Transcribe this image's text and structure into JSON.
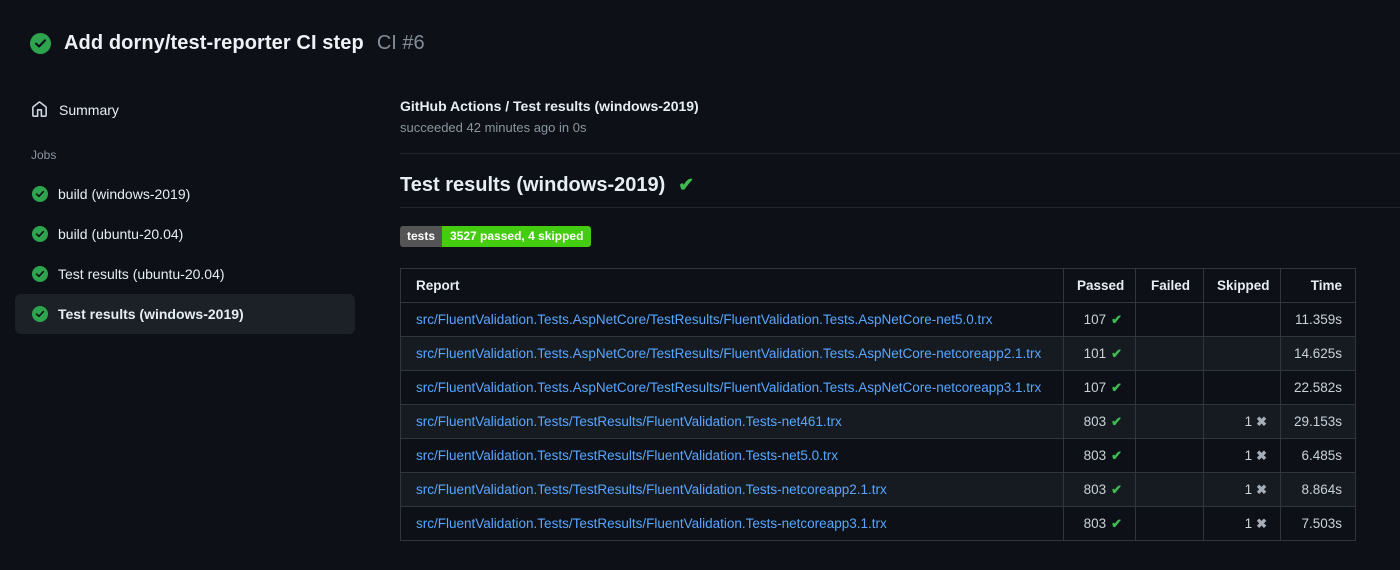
{
  "app_header": {
    "title": "Add dorny/test-reporter CI step",
    "run_ref": "CI #6"
  },
  "sidebar": {
    "summary_label": "Summary",
    "jobs_section_label": "Jobs",
    "jobs": [
      {
        "label": "build (windows-2019)",
        "status": "success",
        "selected": false
      },
      {
        "label": "build (ubuntu-20.04)",
        "status": "success",
        "selected": false
      },
      {
        "label": "Test results (ubuntu-20.04)",
        "status": "success",
        "selected": false
      },
      {
        "label": "Test results (windows-2019)",
        "status": "success",
        "selected": true
      }
    ]
  },
  "main": {
    "check_run_title": "GitHub Actions / Test results (windows-2019)",
    "check_run_status": "succeeded 42 minutes ago in 0s",
    "section_heading": "Test results (windows-2019)",
    "badge": {
      "label": "tests",
      "value": "3527 passed, 4 skipped"
    },
    "table": {
      "headers": [
        "Report",
        "Passed",
        "Failed",
        "Skipped",
        "Time"
      ],
      "rows": [
        {
          "report": "src/FluentValidation.Tests.AspNetCore/TestResults/FluentValidation.Tests.AspNetCore-net5.0.trx",
          "passed": "107",
          "failed": "",
          "skipped": "",
          "time": "11.359s"
        },
        {
          "report": "src/FluentValidation.Tests.AspNetCore/TestResults/FluentValidation.Tests.AspNetCore-netcoreapp2.1.trx",
          "passed": "101",
          "failed": "",
          "skipped": "",
          "time": "14.625s"
        },
        {
          "report": "src/FluentValidation.Tests.AspNetCore/TestResults/FluentValidation.Tests.AspNetCore-netcoreapp3.1.trx",
          "passed": "107",
          "failed": "",
          "skipped": "",
          "time": "22.582s"
        },
        {
          "report": "src/FluentValidation.Tests/TestResults/FluentValidation.Tests-net461.trx",
          "passed": "803",
          "failed": "",
          "skipped": "1",
          "time": "29.153s"
        },
        {
          "report": "src/FluentValidation.Tests/TestResults/FluentValidation.Tests-net5.0.trx",
          "passed": "803",
          "failed": "",
          "skipped": "1",
          "time": "6.485s"
        },
        {
          "report": "src/FluentValidation.Tests/TestResults/FluentValidation.Tests-netcoreapp2.1.trx",
          "passed": "803",
          "failed": "",
          "skipped": "1",
          "time": "8.864s"
        },
        {
          "report": "src/FluentValidation.Tests/TestResults/FluentValidation.Tests-netcoreapp3.1.trx",
          "passed": "803",
          "failed": "",
          "skipped": "1",
          "time": "7.503s"
        }
      ]
    }
  },
  "icons": {
    "pass_check": "✔",
    "skip_cross": "✖",
    "heading_check": "✔"
  },
  "colors": {
    "success_green": "#2ea44f",
    "check_green": "#3fb950",
    "badge_label_bg": "#555555",
    "badge_value_bg": "#44cc11",
    "link_blue": "#58a6ff",
    "background": "#0d1117",
    "row_alt": "#161b22"
  }
}
